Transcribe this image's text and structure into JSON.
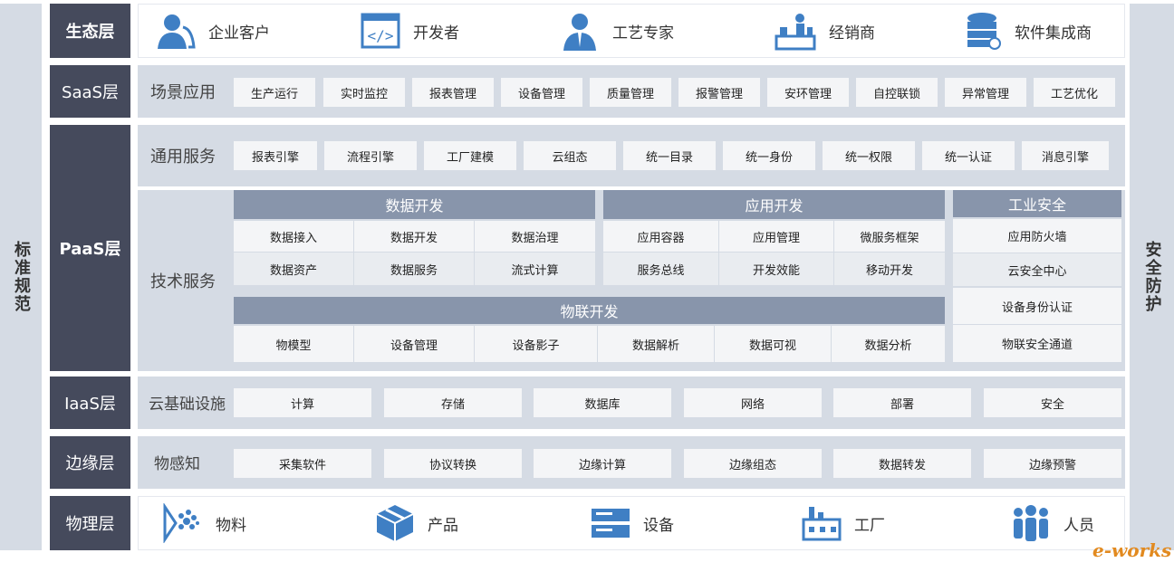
{
  "side_left": "标准规范",
  "side_right": "安全防护",
  "ecosystem": {
    "label": "生态层",
    "items": [
      "企业客户",
      "开发者",
      "工艺专家",
      "经销商",
      "软件集成商"
    ]
  },
  "saas": {
    "label": "SaaS层",
    "row_label": "场景应用",
    "items": [
      "生产运行",
      "实时监控",
      "报表管理",
      "设备管理",
      "质量管理",
      "报警管理",
      "安环管理",
      "自控联锁",
      "异常管理",
      "工艺优化"
    ]
  },
  "paas": {
    "label": "PaaS层",
    "general_label": "通用服务",
    "general_items": [
      "报表引擎",
      "流程引擎",
      "工厂建模",
      "云组态",
      "统一目录",
      "统一身份",
      "统一权限",
      "统一认证",
      "消息引擎"
    ],
    "tech_label": "技术服务",
    "data_dev": {
      "title": "数据开发",
      "rows": [
        [
          "数据接入",
          "数据开发",
          "数据治理"
        ],
        [
          "数据资产",
          "数据服务",
          "流式计算"
        ]
      ]
    },
    "app_dev": {
      "title": "应用开发",
      "rows": [
        [
          "应用容器",
          "应用管理",
          "微服务框架"
        ],
        [
          "服务总线",
          "开发效能",
          "移动开发"
        ]
      ]
    },
    "iot_dev": {
      "title": "物联开发",
      "items": [
        "物模型",
        "设备管理",
        "设备影子",
        "数据解析",
        "数据可视",
        "数据分析"
      ]
    },
    "security": {
      "title": "工业安全",
      "items": [
        "应用防火墙",
        "云安全中心",
        "设备身份认证",
        "物联安全通道"
      ]
    }
  },
  "iaas": {
    "label": "IaaS层",
    "row_label": "云基础设施",
    "items": [
      "计算",
      "存储",
      "数据库",
      "网络",
      "部署",
      "安全"
    ]
  },
  "edge": {
    "label": "边缘层",
    "row_label": "物感知",
    "items": [
      "采集软件",
      "协议转换",
      "边缘计算",
      "边缘组态",
      "数据转发",
      "边缘预警"
    ]
  },
  "physical": {
    "label": "物理层",
    "items": [
      "物料",
      "产品",
      "设备",
      "工厂",
      "人员"
    ]
  },
  "watermark": "e-works",
  "colors": {
    "dark": "#454a5c",
    "panel": "#d5dbe4",
    "header": "#8895ab",
    "icon": "#3f7fc4",
    "chip": "#f4f5f7"
  },
  "icons": {
    "ecosystem": [
      "enterprise-customer-icon",
      "developer-code-icon",
      "craft-expert-icon",
      "distributor-icon",
      "database-integrator-icon"
    ],
    "physical": [
      "material-icon",
      "product-box-icon",
      "equipment-icon",
      "factory-icon",
      "people-icon"
    ]
  }
}
